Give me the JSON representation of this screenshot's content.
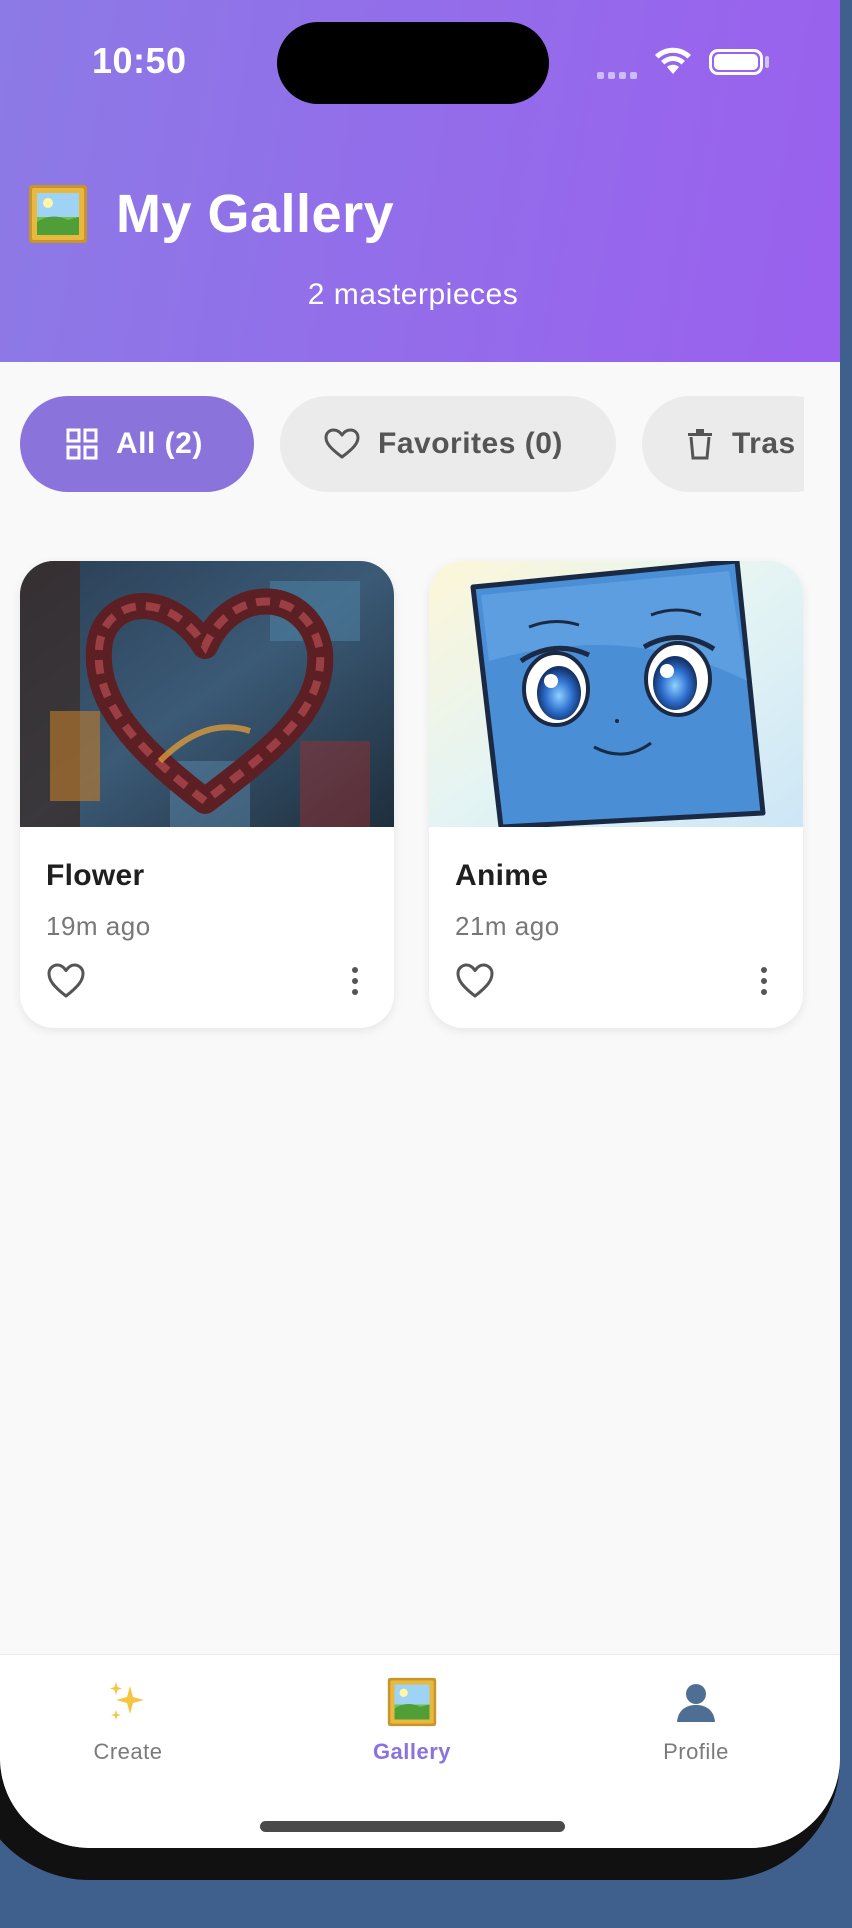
{
  "status_bar": {
    "time": "10:50"
  },
  "header": {
    "title": "My Gallery",
    "subtitle": "2 masterpieces",
    "title_icon": "framed-picture-icon"
  },
  "filters": [
    {
      "label": "All (2)",
      "icon": "grid-icon",
      "selected": true
    },
    {
      "label": "Favorites (0)",
      "icon": "heart-outline-icon",
      "selected": false
    },
    {
      "label": "Tras",
      "icon": "trash-icon",
      "selected": false
    }
  ],
  "cards": [
    {
      "title": "Flower",
      "time": "19m ago",
      "favorite": false
    },
    {
      "title": "Anime",
      "time": "21m ago",
      "favorite": false
    }
  ],
  "bottom_nav": [
    {
      "label": "Create",
      "icon": "sparkles-icon",
      "active": false
    },
    {
      "label": "Gallery",
      "icon": "framed-picture-icon",
      "active": true
    },
    {
      "label": "Profile",
      "icon": "person-silhouette-icon",
      "active": false
    }
  ],
  "colors": {
    "accent": "#8b73dc",
    "header_start": "#8c7ae6",
    "header_end": "#9a60ee"
  }
}
